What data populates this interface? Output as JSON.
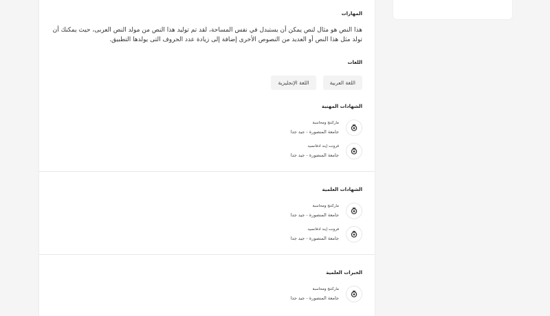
{
  "skills": {
    "title": "المهارات",
    "text": "هذا النص هو مثال لنص يمكن أن يستبدل في نفس المساحة، لقد تم توليد هذا النص من مولد النص العربى، حيث يمكنك أن تولد مثل هذا النص أو العديد من النصوص الأخرى إضافة إلى زيادة عدد الحروف التى يولدها التطبيق."
  },
  "languages": {
    "title": "اللغات",
    "items": [
      "اللغة العربية",
      "اللغة الإنجليزية"
    ]
  },
  "professional_certs": {
    "title": "الشهادات المهنية",
    "items": [
      {
        "name": "ماركتنج ومحاسبة",
        "school": "جامعة المنصورة - جيد جدا"
      },
      {
        "name": "فرونت إيند ادفانسيد",
        "school": "جامعة المنصورة - جيد جدا"
      }
    ]
  },
  "academic_certs": {
    "title": "الشهادات العلمية",
    "items": [
      {
        "name": "ماركتنج ومحاسبة",
        "school": "جامعة المنصورة - جيد جدا"
      },
      {
        "name": "فرونت إيند ادفانسيد",
        "school": "جامعة المنصورة - جيد جدا"
      }
    ]
  },
  "experience": {
    "title": "الخبرات العلمية",
    "items": [
      {
        "name": "ماركتنج ومحاسبة",
        "school": "جامعة المنصورة - جيد جدا"
      }
    ]
  },
  "icons": {
    "cert_icon": "award-badge-icon"
  }
}
